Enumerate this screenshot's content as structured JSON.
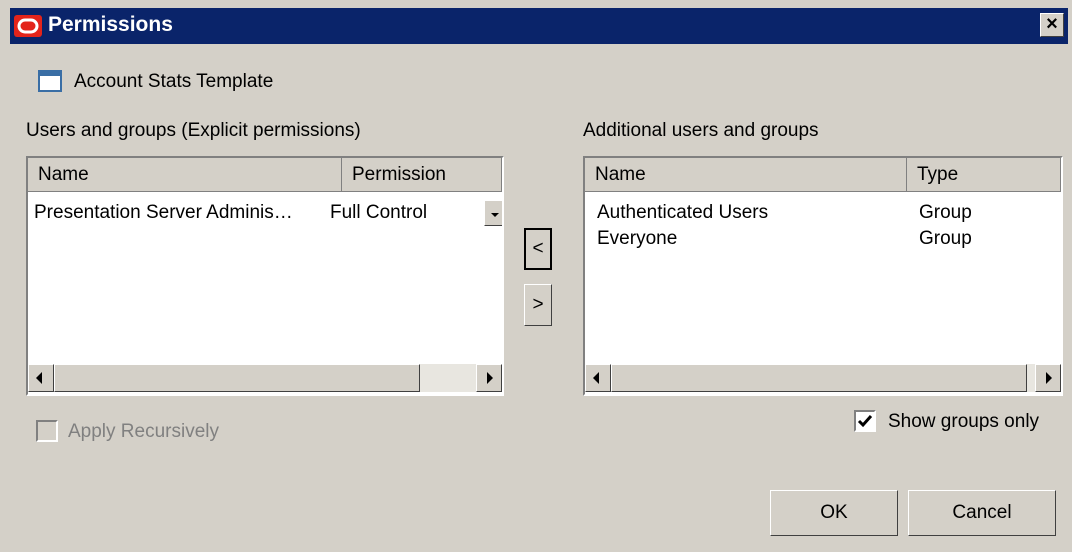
{
  "window": {
    "title": "Permissions",
    "close_label": "×"
  },
  "item": {
    "icon": "window-icon",
    "name": "Account Stats Template"
  },
  "explicit": {
    "label": "Users and groups (Explicit permissions)",
    "columns": [
      "Name",
      "Permission"
    ],
    "rows": [
      {
        "name": "Presentation Server Adminis…",
        "permission": "Full Control"
      }
    ]
  },
  "transfer": {
    "left_label": "<",
    "right_label": ">"
  },
  "additional": {
    "label": "Additional users and groups",
    "columns": [
      "Name",
      "Type"
    ],
    "rows": [
      {
        "name": "Authenticated Users",
        "type": "Group"
      },
      {
        "name": "Everyone",
        "type": "Group"
      }
    ]
  },
  "options": {
    "apply_recursively": {
      "label": "Apply Recursively",
      "checked": false,
      "enabled": false
    },
    "show_groups_only": {
      "label": "Show groups only",
      "checked": true,
      "enabled": true
    }
  },
  "buttons": {
    "ok": "OK",
    "cancel": "Cancel"
  },
  "colors": {
    "titlebar": "#0a246a",
    "dialog": "#d4d0c8",
    "logo": "#e3241b"
  }
}
